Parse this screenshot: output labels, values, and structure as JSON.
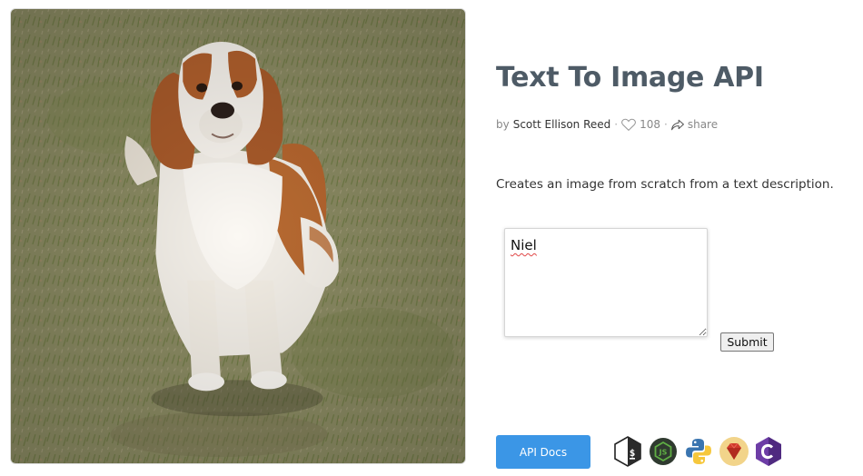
{
  "header": {
    "title": "Text To Image API"
  },
  "meta": {
    "by_label": "by",
    "author": "Scott Ellison Reed",
    "separator": "·",
    "likes": "108",
    "share_label": "share"
  },
  "description": "Creates an image from scratch from a text description.",
  "form": {
    "input_value": "Niel",
    "submit_label": "Submit"
  },
  "footer": {
    "api_docs_label": "API Docs",
    "language_icons": [
      "bash-icon",
      "nodejs-icon",
      "python-icon",
      "ruby-icon",
      "csharp-icon"
    ]
  },
  "colors": {
    "title": "#4e5b66",
    "api_docs_button": "#3b96e6",
    "ruby": "#d13a2a",
    "csharp": "#6d3da6",
    "nodejs": "#3d8b3d"
  }
}
